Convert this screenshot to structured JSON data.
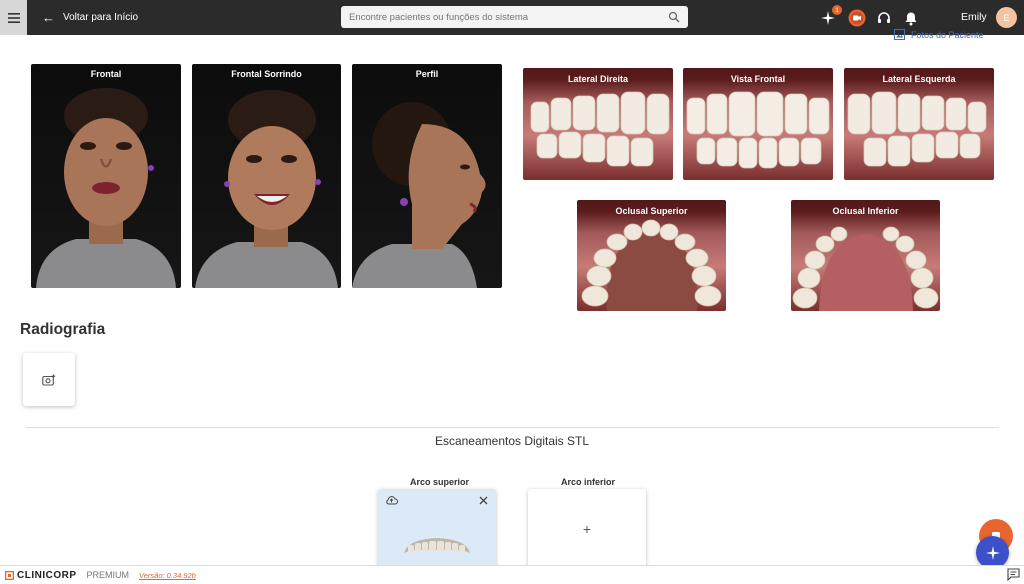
{
  "header": {
    "back_label": "Voltar para Início",
    "search_placeholder": "Encontre pacientes ou funções do sistema",
    "notification_count": "1",
    "user_name": "Emily",
    "user_initial": "E"
  },
  "patient_photos_link": "Fotos do Paciente",
  "face_photos": [
    {
      "label": "Frontal"
    },
    {
      "label": "Frontal Sorrindo"
    },
    {
      "label": "Perfil"
    }
  ],
  "intraoral_photos": [
    {
      "label": "Lateral Direita"
    },
    {
      "label": "Vista Frontal"
    },
    {
      "label": "Lateral Esquerda"
    },
    {
      "label": "Oclusal Superior"
    },
    {
      "label": "Oclusal Inferior"
    }
  ],
  "radiography": {
    "title": "Radiografia"
  },
  "stl": {
    "title": "Escaneamentos Digitais STL",
    "upper_label": "Arco superior",
    "lower_label": "Arco inferior",
    "add_symbol": "+"
  },
  "footer": {
    "brand": "CLINICORP",
    "plan": "PREMIUM",
    "version": "Versão: 0.34.92b"
  },
  "colors": {
    "accent": "#e8652f",
    "fab_blue": "#3b50c9",
    "topbar": "#2b2b2b"
  }
}
